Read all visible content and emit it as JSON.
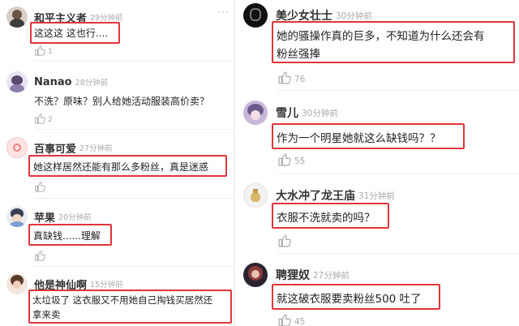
{
  "left": {
    "comments": [
      {
        "author": "和平主义者",
        "time": "29分钟前",
        "text": "这这这 这也行....",
        "likes": "1",
        "highlighted": true
      },
      {
        "author": "Nanao",
        "time": "28分钟前",
        "text": "不洗？原味？别人给她活动服装高价卖？",
        "likes": "2",
        "highlighted": false
      },
      {
        "author": "百事可爱",
        "time": "27分钟前",
        "text": "她这样居然还能有那么多粉丝，真是迷惑",
        "likes": "",
        "highlighted": true
      },
      {
        "author": "苹果",
        "time": "20分钟前",
        "text": "真缺钱......理解",
        "likes": "",
        "highlighted": true
      },
      {
        "author": "他是神仙啊",
        "time": "15分钟前",
        "text_line1": "太垃圾了 这衣服又不用她自己掏钱买居然还",
        "text_line2": "拿来卖",
        "highlighted": true
      }
    ]
  },
  "right": {
    "comments": [
      {
        "author": "美少女壮士",
        "time": "30分钟前",
        "text_line1": "她的骚操作真的巨多，不知道为什么还会有",
        "text_line2": "粉丝强捧",
        "likes": "76",
        "highlighted": true
      },
      {
        "author": "雪儿",
        "time": "30分钟前",
        "text": "作为一个明星她就这么缺钱吗？？",
        "likes": "55",
        "highlighted": true
      },
      {
        "author": "大水冲了龙王庙",
        "time": "31分钟前",
        "text": "衣服不洗就卖的吗？",
        "likes": "",
        "highlighted": true
      },
      {
        "author": "聘狸奴",
        "time": "27分钟前",
        "text": "就这破衣服要卖粉丝500 吐了",
        "likes": "45",
        "highlighted": true
      }
    ]
  },
  "icons": {
    "more": "more-dots-icon",
    "like": "thumbs-up-icon"
  },
  "colors": {
    "highlight": "#e0353b",
    "time": "#a8a8a8",
    "divider": "#f1f1f1"
  }
}
